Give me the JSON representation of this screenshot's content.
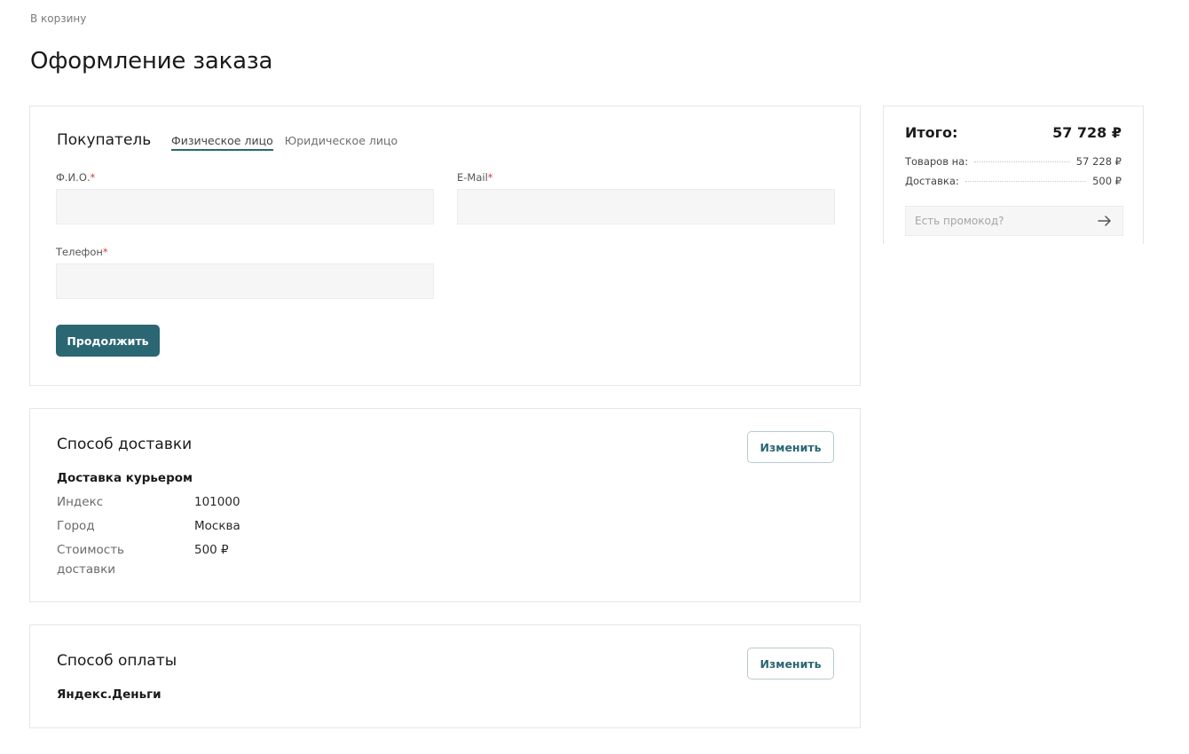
{
  "nav": {
    "back_label": "В корзину"
  },
  "page": {
    "title": "Оформление заказа"
  },
  "buyer": {
    "title": "Покупатель",
    "tabs": [
      "Физическое лицо",
      "Юридическое лицо"
    ],
    "active_tab": "Физическое лицо",
    "fields": {
      "name": {
        "label": "Ф.И.О.",
        "required_mark": "*",
        "value": ""
      },
      "email": {
        "label": "E-Mail",
        "required_mark": "*",
        "value": ""
      },
      "phone": {
        "label": "Телефон",
        "required_mark": "*",
        "value": ""
      }
    },
    "continue_label": "Продолжить"
  },
  "delivery": {
    "title": "Способ доставки",
    "change_label": "Изменить",
    "method": "Доставка курьером",
    "details": [
      {
        "key": "Индекс",
        "value": "101000"
      },
      {
        "key": "Город",
        "value": "Москва"
      },
      {
        "key": "Стоимость доставки",
        "value": "500 ₽"
      }
    ]
  },
  "payment": {
    "title": "Способ оплаты",
    "change_label": "Изменить",
    "method": "Яндекс.Деньги"
  },
  "summary": {
    "title": "Итого:",
    "total": "57 728 ₽",
    "rows": [
      {
        "label": "Товаров на:",
        "value": "57 228 ₽"
      },
      {
        "label": "Доставка:",
        "value": "500 ₽"
      }
    ],
    "promo_placeholder": "Есть промокод?",
    "promo_icon": "arrow-right-icon"
  },
  "colors": {
    "accent": "#2b6673",
    "required": "#d23b3b",
    "input_bg": "#f6f6f6"
  }
}
